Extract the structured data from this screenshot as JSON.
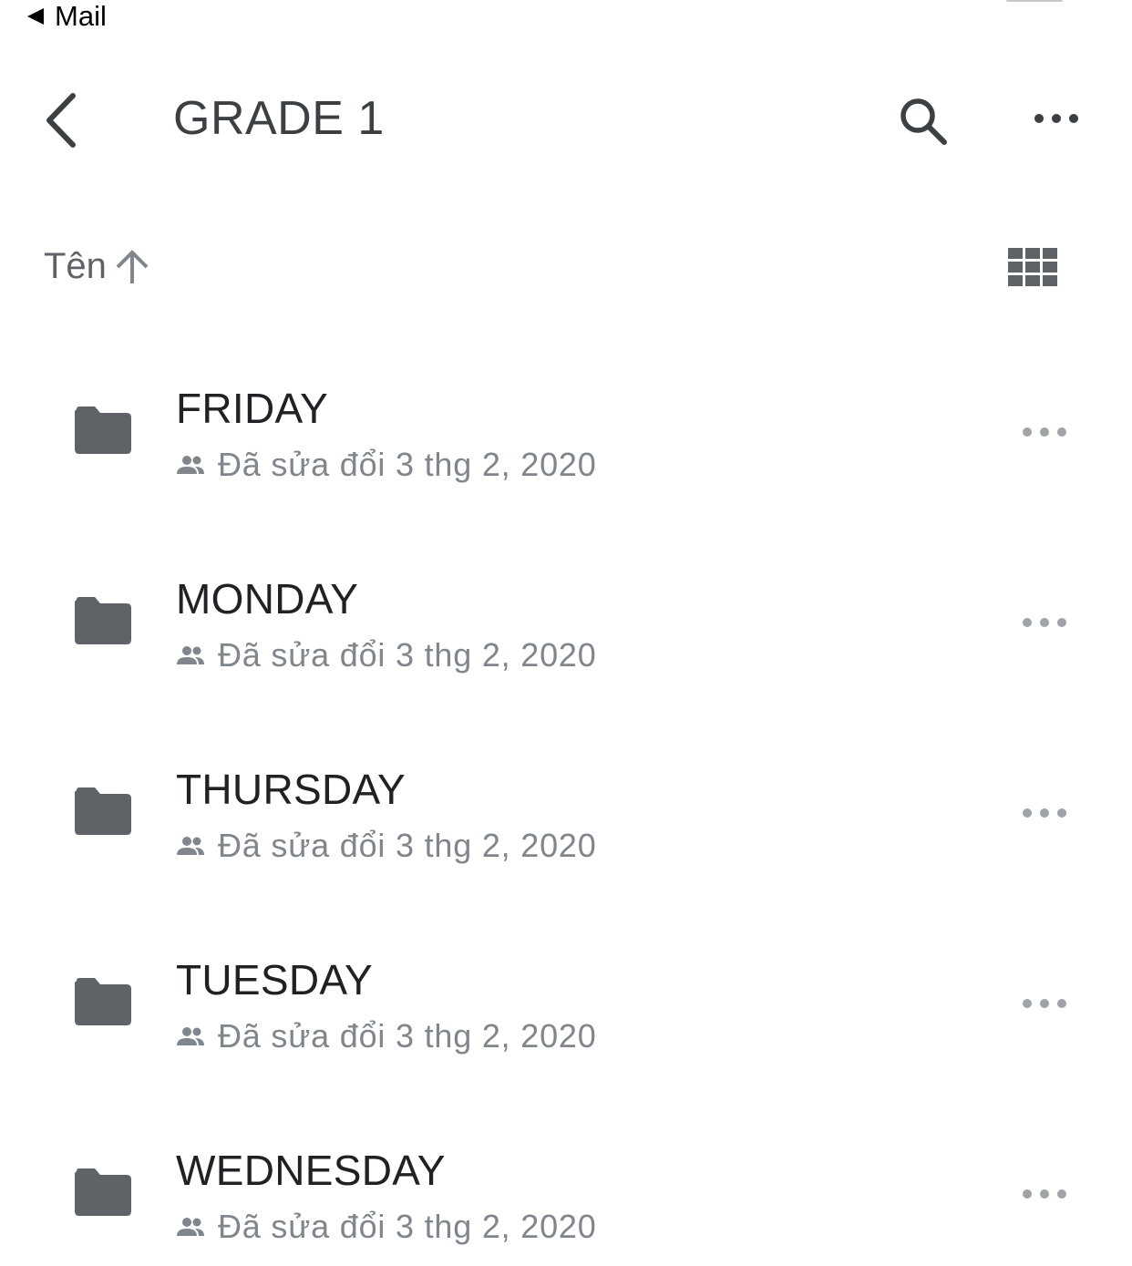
{
  "status_bar": {
    "back_app_label": "Mail"
  },
  "header": {
    "title": "GRADE 1"
  },
  "sort": {
    "label": "Tên"
  },
  "colors": {
    "folder": "#5f6368",
    "meta_text": "#80868b",
    "title": "#3c4043",
    "row_more": "#a0a4a8"
  },
  "icons": {
    "back": "chevron-left-icon",
    "search": "search-icon",
    "more": "more-horizontal-icon",
    "sort_direction": "arrow-up-icon",
    "view_mode": "grid-view-icon",
    "folder": "folder-icon",
    "shared": "people-icon"
  },
  "folders": [
    {
      "name": "FRIDAY",
      "modified": "Đã sửa đổi 3 thg 2, 2020"
    },
    {
      "name": "MONDAY",
      "modified": "Đã sửa đổi 3 thg 2, 2020"
    },
    {
      "name": "THURSDAY",
      "modified": "Đã sửa đổi 3 thg 2, 2020"
    },
    {
      "name": "TUESDAY",
      "modified": "Đã sửa đổi 3 thg 2, 2020"
    },
    {
      "name": "WEDNESDAY",
      "modified": "Đã sửa đổi 3 thg 2, 2020"
    }
  ]
}
